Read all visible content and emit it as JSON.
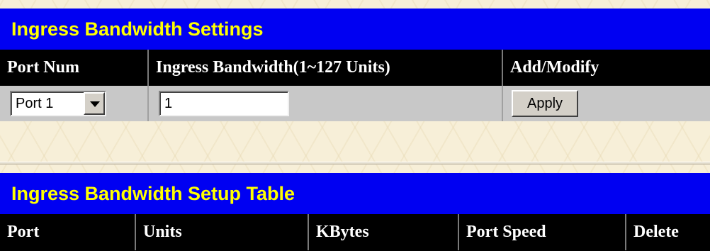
{
  "settings": {
    "title": "Ingress Bandwidth Settings",
    "columns": [
      "Port Num",
      "Ingress Bandwidth(1~127 Units)",
      "Add/Modify"
    ],
    "port_select_value": "Port 1",
    "bandwidth_value": "1",
    "apply_label": "Apply"
  },
  "table": {
    "title": "Ingress Bandwidth Setup Table",
    "columns": [
      "Port",
      "Units",
      "KBytes",
      "Port Speed",
      "Delete"
    ]
  },
  "colors": {
    "header_bg": "#0000f2",
    "header_text": "#ffff00",
    "column_header_bg": "#000000",
    "row_bg": "#c8c8c8"
  },
  "icons": {
    "select_arrow": "chevron-down-icon"
  }
}
